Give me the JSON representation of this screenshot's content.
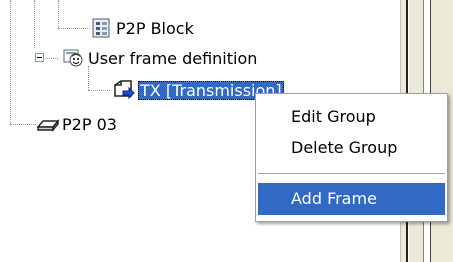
{
  "tree": {
    "items": [
      {
        "label": "P2P Block",
        "icon": "block-icon"
      },
      {
        "label": "User frame definition",
        "icon": "user-frame-icon"
      },
      {
        "label": "TX  [Transmission]",
        "icon": "transmission-icon",
        "selected": true
      },
      {
        "label": "P2P 03",
        "icon": "port-icon"
      }
    ]
  },
  "context_menu": {
    "items": [
      "Edit Group",
      "Delete Group",
      "Add Frame"
    ],
    "highlighted": "Add Frame"
  },
  "colors": {
    "selection": "#316ac5",
    "menu_bg": "#ffffff",
    "pane_bg": "#ece9d8"
  }
}
